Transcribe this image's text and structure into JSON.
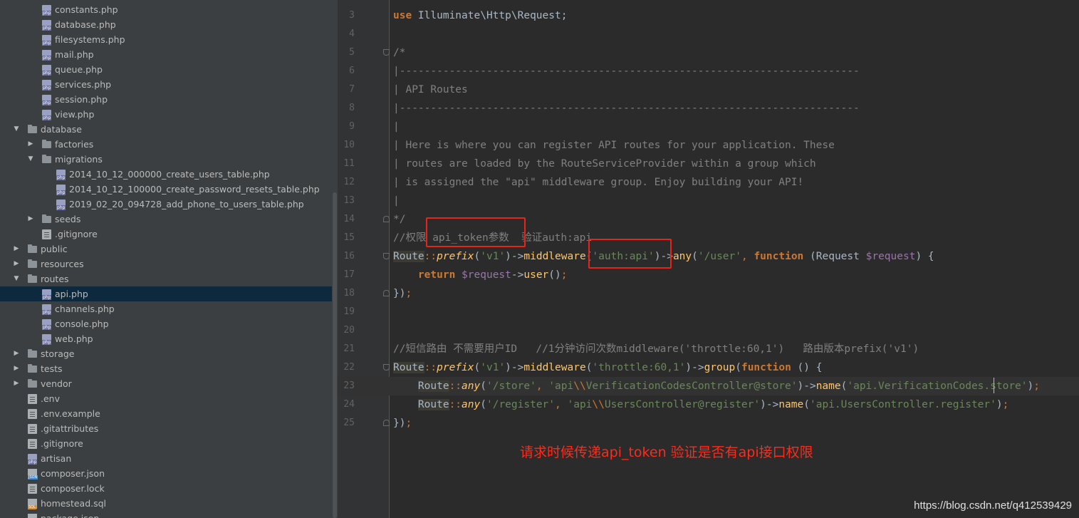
{
  "project_tree": {
    "items": [
      {
        "label": "constants.php",
        "icon": "php-file-icon",
        "depth": 2,
        "arrow": ""
      },
      {
        "label": "database.php",
        "icon": "php-file-icon",
        "depth": 2,
        "arrow": ""
      },
      {
        "label": "filesystems.php",
        "icon": "php-file-icon",
        "depth": 2,
        "arrow": ""
      },
      {
        "label": "mail.php",
        "icon": "php-file-icon",
        "depth": 2,
        "arrow": ""
      },
      {
        "label": "queue.php",
        "icon": "php-file-icon",
        "depth": 2,
        "arrow": ""
      },
      {
        "label": "services.php",
        "icon": "php-file-icon",
        "depth": 2,
        "arrow": ""
      },
      {
        "label": "session.php",
        "icon": "php-file-icon",
        "depth": 2,
        "arrow": ""
      },
      {
        "label": "view.php",
        "icon": "php-file-icon",
        "depth": 2,
        "arrow": ""
      },
      {
        "label": "database",
        "icon": "folder-icon",
        "depth": 1,
        "arrow": "expanded"
      },
      {
        "label": "factories",
        "icon": "folder-icon",
        "depth": 2,
        "arrow": "collapsed"
      },
      {
        "label": "migrations",
        "icon": "folder-icon",
        "depth": 2,
        "arrow": "expanded"
      },
      {
        "label": "2014_10_12_000000_create_users_table.php",
        "icon": "php-file-icon",
        "depth": 3,
        "arrow": ""
      },
      {
        "label": "2014_10_12_100000_create_password_resets_table.php",
        "icon": "php-file-icon",
        "depth": 3,
        "arrow": ""
      },
      {
        "label": "2019_02_20_094728_add_phone_to_users_table.php",
        "icon": "php-file-icon",
        "depth": 3,
        "arrow": ""
      },
      {
        "label": "seeds",
        "icon": "folder-icon",
        "depth": 2,
        "arrow": "collapsed"
      },
      {
        "label": ".gitignore",
        "icon": "text-file-icon",
        "depth": 2,
        "arrow": ""
      },
      {
        "label": "public",
        "icon": "folder-icon",
        "depth": 1,
        "arrow": "collapsed"
      },
      {
        "label": "resources",
        "icon": "folder-icon",
        "depth": 1,
        "arrow": "collapsed"
      },
      {
        "label": "routes",
        "icon": "folder-icon",
        "depth": 1,
        "arrow": "expanded"
      },
      {
        "label": "api.php",
        "icon": "php-file-icon",
        "depth": 2,
        "arrow": "",
        "selected": true
      },
      {
        "label": "channels.php",
        "icon": "php-file-icon",
        "depth": 2,
        "arrow": ""
      },
      {
        "label": "console.php",
        "icon": "php-file-icon",
        "depth": 2,
        "arrow": ""
      },
      {
        "label": "web.php",
        "icon": "php-file-icon",
        "depth": 2,
        "arrow": ""
      },
      {
        "label": "storage",
        "icon": "folder-icon",
        "depth": 1,
        "arrow": "collapsed"
      },
      {
        "label": "tests",
        "icon": "folder-icon",
        "depth": 1,
        "arrow": "collapsed"
      },
      {
        "label": "vendor",
        "icon": "folder-icon",
        "depth": 1,
        "arrow": "collapsed"
      },
      {
        "label": ".env",
        "icon": "text-file-icon",
        "depth": 1,
        "arrow": ""
      },
      {
        "label": ".env.example",
        "icon": "text-file-icon",
        "depth": 1,
        "arrow": ""
      },
      {
        "label": ".gitattributes",
        "icon": "text-file-icon",
        "depth": 1,
        "arrow": ""
      },
      {
        "label": ".gitignore",
        "icon": "text-file-icon",
        "depth": 1,
        "arrow": ""
      },
      {
        "label": "artisan",
        "icon": "php-file-icon",
        "depth": 1,
        "arrow": ""
      },
      {
        "label": "composer.json",
        "icon": "json-file-icon",
        "depth": 1,
        "arrow": ""
      },
      {
        "label": "composer.lock",
        "icon": "text-file-icon",
        "depth": 1,
        "arrow": ""
      },
      {
        "label": "homestead.sql",
        "icon": "sql-file-icon",
        "depth": 1,
        "arrow": ""
      },
      {
        "label": "package.json",
        "icon": "json-file-icon",
        "depth": 1,
        "arrow": ""
      }
    ]
  },
  "editor": {
    "lines": [
      {
        "num": "3",
        "tokens": [
          [
            "kw",
            "use"
          ],
          [
            "plain",
            " Illuminate\\Http\\Request;"
          ]
        ]
      },
      {
        "num": "4",
        "tokens": []
      },
      {
        "num": "5",
        "fold": "open",
        "tokens": [
          [
            "cm",
            "/*"
          ]
        ]
      },
      {
        "num": "6",
        "tokens": [
          [
            "cm",
            "|--------------------------------------------------------------------------"
          ]
        ]
      },
      {
        "num": "7",
        "tokens": [
          [
            "cm",
            "| API Routes"
          ]
        ]
      },
      {
        "num": "8",
        "tokens": [
          [
            "cm",
            "|--------------------------------------------------------------------------"
          ]
        ]
      },
      {
        "num": "9",
        "tokens": [
          [
            "cm",
            "|"
          ]
        ]
      },
      {
        "num": "10",
        "tokens": [
          [
            "cm",
            "| Here is where you can register API routes for your application. These"
          ]
        ]
      },
      {
        "num": "11",
        "tokens": [
          [
            "cm",
            "| routes are loaded by the RouteServiceProvider within a group which"
          ]
        ]
      },
      {
        "num": "12",
        "tokens": [
          [
            "cm",
            "| is assigned the \"api\" middleware group. Enjoy building your API!"
          ]
        ]
      },
      {
        "num": "13",
        "tokens": [
          [
            "cm",
            "|"
          ]
        ]
      },
      {
        "num": "14",
        "fold": "close",
        "tokens": [
          [
            "cm",
            "*/"
          ]
        ]
      },
      {
        "num": "15",
        "tokens": [
          [
            "cm",
            "//权限 api_token参数  验证auth:api"
          ]
        ]
      },
      {
        "num": "16",
        "fold": "open",
        "tokens": [
          [
            "route",
            "Route"
          ],
          [
            "cn",
            "::"
          ],
          [
            "st",
            "prefix"
          ],
          [
            "plain",
            "("
          ],
          [
            "str",
            "'v1'"
          ],
          [
            "plain",
            ")->"
          ],
          [
            "fn",
            "middleware"
          ],
          [
            "plain",
            "("
          ],
          [
            "str",
            "'auth:api'"
          ],
          [
            "plain",
            ")->"
          ],
          [
            "fn",
            "any"
          ],
          [
            "plain",
            "("
          ],
          [
            "str",
            "'/user'"
          ],
          [
            "cn",
            ", "
          ],
          [
            "kw",
            "function"
          ],
          [
            "plain",
            " (Request "
          ],
          [
            "var",
            "$request"
          ],
          [
            "plain",
            ") {"
          ]
        ]
      },
      {
        "num": "17",
        "tokens": [
          [
            "plain",
            "    "
          ],
          [
            "kw",
            "return"
          ],
          [
            "plain",
            " "
          ],
          [
            "var",
            "$request"
          ],
          [
            "plain",
            "->"
          ],
          [
            "fn",
            "user"
          ],
          [
            "plain",
            "()"
          ],
          [
            "cn",
            ";"
          ]
        ]
      },
      {
        "num": "18",
        "fold": "close",
        "tokens": [
          [
            "plain",
            "})"
          ],
          [
            "cn",
            ";"
          ]
        ]
      },
      {
        "num": "19",
        "tokens": []
      },
      {
        "num": "20",
        "tokens": []
      },
      {
        "num": "21",
        "tokens": [
          [
            "cm",
            "//短信路由 不需要用户ID   //1分钟访问次数middleware('throttle:60,1')   路由版本prefix('v1')"
          ]
        ]
      },
      {
        "num": "22",
        "fold": "open",
        "tokens": [
          [
            "route",
            "Route"
          ],
          [
            "cn",
            "::"
          ],
          [
            "st",
            "prefix"
          ],
          [
            "plain",
            "("
          ],
          [
            "str",
            "'v1'"
          ],
          [
            "plain",
            ")->"
          ],
          [
            "fn",
            "middleware"
          ],
          [
            "plain",
            "("
          ],
          [
            "str",
            "'throttle:60,1'"
          ],
          [
            "plain",
            ")->"
          ],
          [
            "fn",
            "group"
          ],
          [
            "plain",
            "("
          ],
          [
            "kw",
            "function"
          ],
          [
            "plain",
            " () {"
          ]
        ]
      },
      {
        "num": "23",
        "current": true,
        "tokens": [
          [
            "plain",
            "    "
          ],
          [
            "route",
            "Route"
          ],
          [
            "cn",
            "::"
          ],
          [
            "st",
            "any"
          ],
          [
            "plain",
            "("
          ],
          [
            "str",
            "'/store'"
          ],
          [
            "cn",
            ", "
          ],
          [
            "str",
            "'api"
          ],
          [
            "esc",
            "\\\\"
          ],
          [
            "str",
            "VerificationCodesController@store'"
          ],
          [
            "plain",
            ")->"
          ],
          [
            "fn",
            "name"
          ],
          [
            "plain",
            "("
          ],
          [
            "str",
            "'api.VerificationCodes.store'"
          ],
          [
            "plain",
            ")"
          ],
          [
            "cn",
            ";"
          ]
        ]
      },
      {
        "num": "24",
        "tokens": [
          [
            "plain",
            "    "
          ],
          [
            "route",
            "Route"
          ],
          [
            "cn",
            "::"
          ],
          [
            "st",
            "any"
          ],
          [
            "plain",
            "("
          ],
          [
            "str",
            "'/register'"
          ],
          [
            "cn",
            ", "
          ],
          [
            "str",
            "'api"
          ],
          [
            "esc",
            "\\\\"
          ],
          [
            "str",
            "UsersController@register'"
          ],
          [
            "plain",
            ")->"
          ],
          [
            "fn",
            "name"
          ],
          [
            "plain",
            "("
          ],
          [
            "str",
            "'api.UsersController.register'"
          ],
          [
            "plain",
            ")"
          ],
          [
            "cn",
            ";"
          ]
        ]
      },
      {
        "num": "25",
        "fold": "close",
        "tokens": [
          [
            "plain",
            "})"
          ],
          [
            "cn",
            ";"
          ]
        ]
      }
    ]
  },
  "annotation_text": "请求时候传递api_token 验证是否有api接口权限",
  "watermark_text": "https://blog.csdn.net/q412539429",
  "colors": {
    "annotation": "#ff2a1a",
    "highlight_box": "#e8241a",
    "keyword": "#cc7832",
    "string": "#6a8759",
    "comment": "#808080",
    "variable": "#9876aa",
    "function": "#ffc66d"
  }
}
